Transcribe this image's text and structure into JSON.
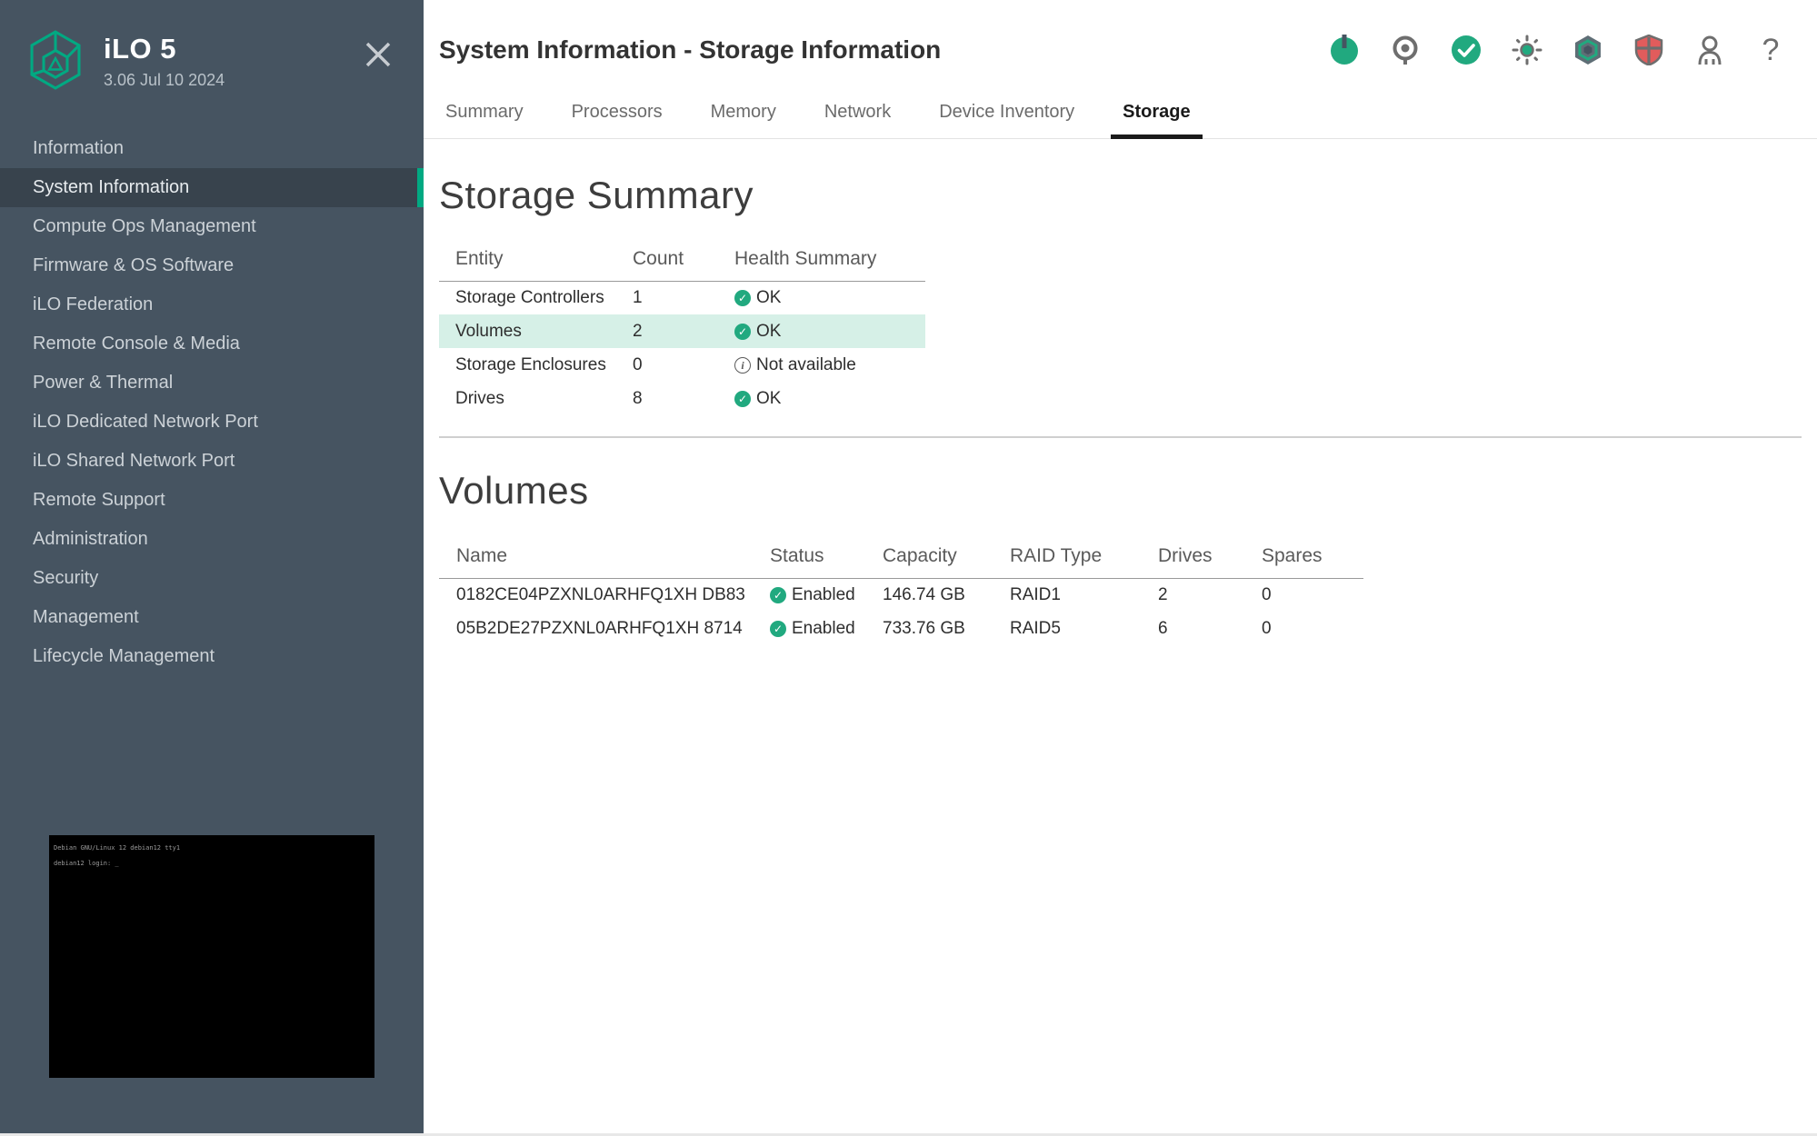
{
  "sidebar": {
    "app_title": "iLO 5",
    "version": "3.06 Jul 10 2024",
    "items": [
      {
        "label": "Information",
        "selected": false
      },
      {
        "label": "System Information",
        "selected": true
      },
      {
        "label": "Compute Ops Management",
        "selected": false
      },
      {
        "label": "Firmware & OS Software",
        "selected": false
      },
      {
        "label": "iLO Federation",
        "selected": false
      },
      {
        "label": "Remote Console & Media",
        "selected": false
      },
      {
        "label": "Power & Thermal",
        "selected": false
      },
      {
        "label": "iLO Dedicated Network Port",
        "selected": false
      },
      {
        "label": "iLO Shared Network Port",
        "selected": false
      },
      {
        "label": "Remote Support",
        "selected": false
      },
      {
        "label": "Administration",
        "selected": false
      },
      {
        "label": "Security",
        "selected": false
      },
      {
        "label": "Management",
        "selected": false
      },
      {
        "label": "Lifecycle Management",
        "selected": false
      }
    ],
    "console_preview": {
      "line1": "Debian GNU/Linux 12 debian12 tty1",
      "line2": "debian12 login: _"
    }
  },
  "header": {
    "title": "System Information - Storage Information",
    "icons": [
      "power-icon",
      "uid-icon",
      "health-ok-icon",
      "brightness-icon",
      "firmware-hexagon-icon",
      "security-shield-icon",
      "user-icon",
      "help-icon"
    ]
  },
  "tabs": [
    {
      "label": "Summary",
      "active": false
    },
    {
      "label": "Processors",
      "active": false
    },
    {
      "label": "Memory",
      "active": false
    },
    {
      "label": "Network",
      "active": false
    },
    {
      "label": "Device Inventory",
      "active": false
    },
    {
      "label": "Storage",
      "active": true
    }
  ],
  "storage_summary": {
    "heading": "Storage Summary",
    "columns": [
      "Entity",
      "Count",
      "Health Summary"
    ],
    "rows": [
      {
        "entity": "Storage Controllers",
        "count": "1",
        "health": "OK",
        "icon": "ok",
        "highlighted": false
      },
      {
        "entity": "Volumes",
        "count": "2",
        "health": "OK",
        "icon": "ok",
        "highlighted": true
      },
      {
        "entity": "Storage Enclosures",
        "count": "0",
        "health": "Not available",
        "icon": "info",
        "highlighted": false
      },
      {
        "entity": "Drives",
        "count": "8",
        "health": "OK",
        "icon": "ok",
        "highlighted": false
      }
    ]
  },
  "volumes": {
    "heading": "Volumes",
    "columns": [
      "Name",
      "Status",
      "Capacity",
      "RAID Type",
      "Drives",
      "Spares"
    ],
    "rows": [
      {
        "name": "0182CE04PZXNL0ARHFQ1XH DB83",
        "status": "Enabled",
        "icon": "ok",
        "capacity": "146.74 GB",
        "raid": "RAID1",
        "drives": "2",
        "spares": "0"
      },
      {
        "name": "05B2DE27PZXNL0ARHFQ1XH 8714",
        "status": "Enabled",
        "icon": "ok",
        "capacity": "733.76 GB",
        "raid": "RAID5",
        "drives": "6",
        "spares": "0"
      }
    ]
  },
  "colors": {
    "brand_green": "#01a982",
    "sidebar_bg": "#465461",
    "sidebar_selected_bg": "#38434d",
    "highlight_row": "#d6f0e7",
    "ok_green": "#21a97f",
    "shield_red": "#e25c5c",
    "active_tab_underline": "#1a1a1a"
  }
}
